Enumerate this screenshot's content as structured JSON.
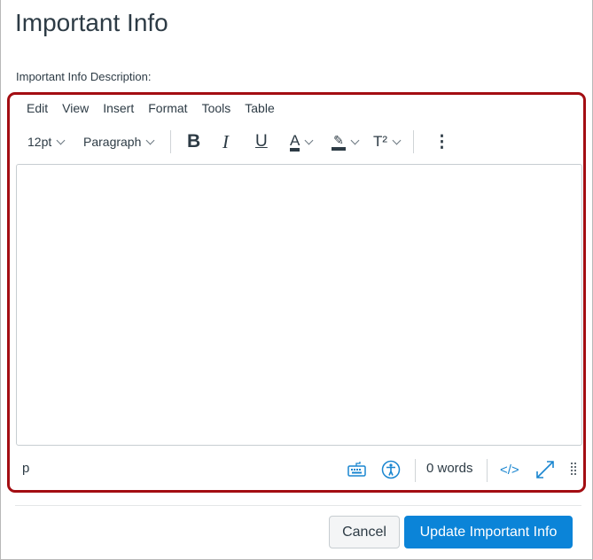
{
  "title": "Important Info",
  "description_label": "Important Info Description:",
  "menu": [
    "Edit",
    "View",
    "Insert",
    "Format",
    "Tools",
    "Table"
  ],
  "toolbar": {
    "font_size": "12pt",
    "block_format": "Paragraph",
    "bold": "B",
    "italic": "I",
    "underline": "U",
    "text_color": "A",
    "superscript": "T²",
    "more": "⋮"
  },
  "status": {
    "path": "p",
    "word_count": "0 words",
    "html_toggle": "</>"
  },
  "buttons": {
    "cancel": "Cancel",
    "update": "Update Important Info"
  },
  "colors": {
    "accent": "#0b84d8",
    "focus_border": "#a30d12"
  }
}
